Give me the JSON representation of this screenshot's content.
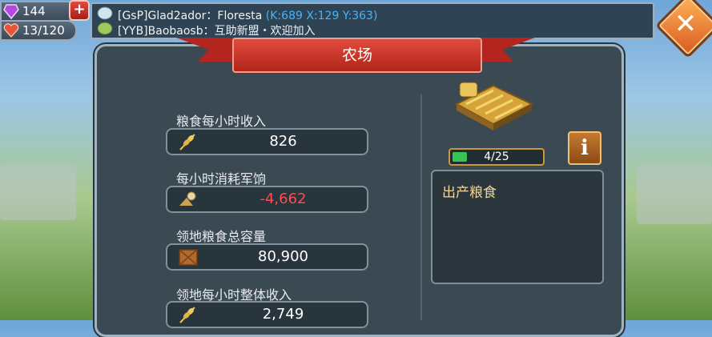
{
  "hud": {
    "gems": "144",
    "stamina": "13/120"
  },
  "chat": {
    "line1_name": "[GsP]Glad2ador：Floresta",
    "line1_coords": "(K:689 X:129 Y:363)",
    "line2": "[YYB]Baobaosb：互助新盟・欢迎加入"
  },
  "panel": {
    "title": "农场",
    "stats": [
      {
        "label": "粮食每小时收入",
        "value": "826",
        "icon": "wheat-icon"
      },
      {
        "label": "每小时消耗军饷",
        "value": "-4,662",
        "icon": "army-upkeep-icon"
      },
      {
        "label": "领地粮食总容量",
        "value": "80,900",
        "icon": "storage-crate-icon"
      },
      {
        "label": "领地每小时整体收入",
        "value": "2,749",
        "icon": "wheat-icon"
      }
    ],
    "level_text": "4/25",
    "level_fraction": 0.16,
    "info_label": "i",
    "description_title": "出产粮食"
  },
  "colors": {
    "negative": "#ff4a52",
    "banner": "#c9342a",
    "coords": "#44b5ff",
    "level_fill": "#35c455"
  }
}
